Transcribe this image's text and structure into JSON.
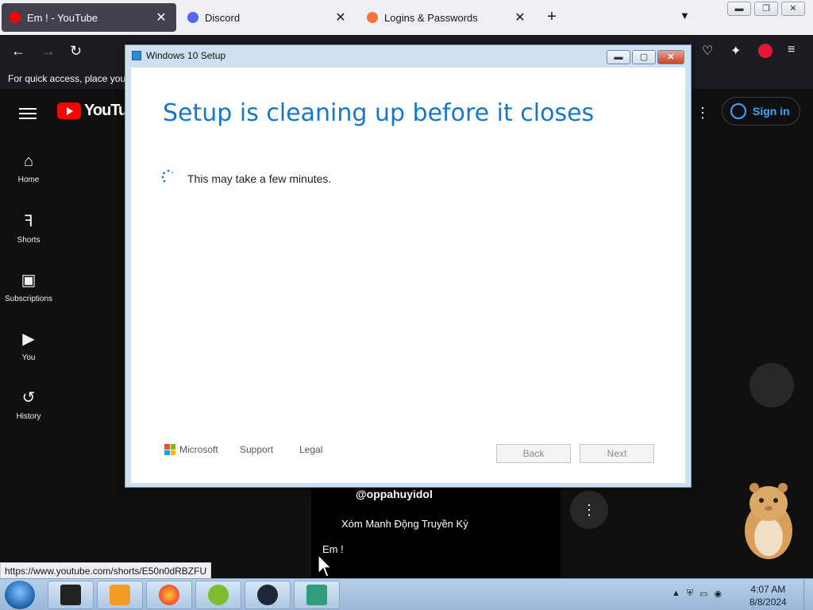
{
  "browser": {
    "tabs": [
      {
        "label": "Em ! - YouTube",
        "active": true,
        "icon": "youtube-icon",
        "color": "#ff0000"
      },
      {
        "label": "Discord",
        "active": false,
        "icon": "discord-icon",
        "color": "#5865f2"
      },
      {
        "label": "Logins & Passwords",
        "active": false,
        "icon": "firefox-icon",
        "color": "#ff7139"
      }
    ],
    "bookmark_hint": "For quick access, place your"
  },
  "youtube": {
    "logo_text": "YouTube",
    "sign_in": "Sign in",
    "sidebar": [
      {
        "label": "Home",
        "icon": "home-icon"
      },
      {
        "label": "Shorts",
        "icon": "shorts-icon"
      },
      {
        "label": "Subscriptions",
        "icon": "subscriptions-icon"
      },
      {
        "label": "You",
        "icon": "you-icon"
      },
      {
        "label": "History",
        "icon": "history-icon"
      }
    ],
    "short": {
      "channel": "@oppahuyidol",
      "song": "Xóm Manh Động Truyền Kỳ",
      "title": "Em !"
    },
    "status_url": "https://www.youtube.com/shorts/E50n0dRBZFU"
  },
  "dialog": {
    "window_title": "Windows 10 Setup",
    "heading": "Setup is cleaning up before it closes",
    "message": "This may take a few minutes.",
    "brand": "Microsoft",
    "support": "Support",
    "legal": "Legal",
    "back": "Back",
    "next": "Next",
    "accent": "#1a76c7"
  },
  "taskbar": {
    "time": "4:07 AM",
    "date": "8/8/2024"
  }
}
